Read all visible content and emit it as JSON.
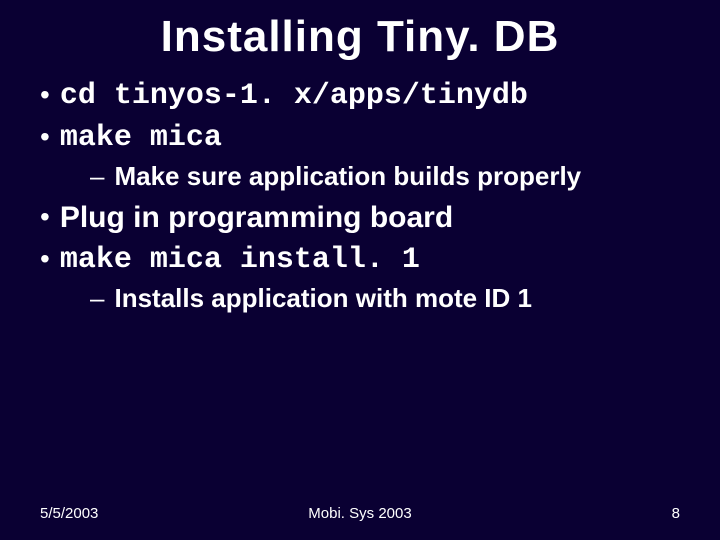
{
  "title": "Installing Tiny. DB",
  "bullets": [
    {
      "text": "cd tinyos-1. x/apps/tinydb",
      "mono": true
    },
    {
      "text": "make mica",
      "mono": true,
      "sub": "Make sure application builds properly"
    },
    {
      "text": "Plug in programming board",
      "mono": false
    },
    {
      "text": "make mica install. 1",
      "mono": true,
      "sub": "Installs application with mote ID 1"
    }
  ],
  "footer": {
    "left": "5/5/2003",
    "center": "Mobi. Sys 2003",
    "right": "8"
  }
}
